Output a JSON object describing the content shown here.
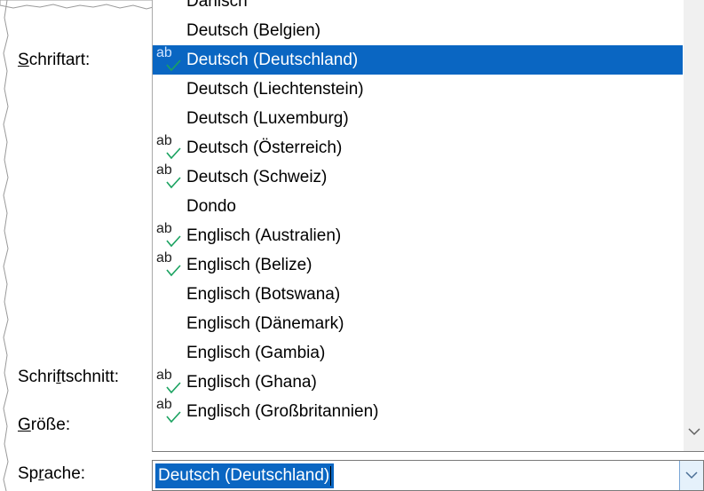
{
  "labels": {
    "font": {
      "pre": "",
      "accel": "S",
      "post": "chriftart:"
    },
    "style": {
      "pre": "Schri",
      "accel": "f",
      "post": "tschnitt:"
    },
    "size": {
      "pre": "",
      "accel": "G",
      "post": "röße:"
    },
    "language": {
      "pre": "Sp",
      "accel": "r",
      "post": "ache:"
    }
  },
  "spell_check_glyph": "ab",
  "language_list": [
    {
      "label": "Dänisch",
      "spellcheck": false,
      "selected": false
    },
    {
      "label": "Deutsch (Belgien)",
      "spellcheck": false,
      "selected": false
    },
    {
      "label": "Deutsch (Deutschland)",
      "spellcheck": true,
      "selected": true
    },
    {
      "label": "Deutsch (Liechtenstein)",
      "spellcheck": false,
      "selected": false
    },
    {
      "label": "Deutsch (Luxemburg)",
      "spellcheck": false,
      "selected": false
    },
    {
      "label": "Deutsch (Österreich)",
      "spellcheck": true,
      "selected": false
    },
    {
      "label": "Deutsch (Schweiz)",
      "spellcheck": true,
      "selected": false
    },
    {
      "label": "Dondo",
      "spellcheck": false,
      "selected": false
    },
    {
      "label": "Englisch (Australien)",
      "spellcheck": true,
      "selected": false
    },
    {
      "label": "Englisch (Belize)",
      "spellcheck": true,
      "selected": false
    },
    {
      "label": "Englisch (Botswana)",
      "spellcheck": false,
      "selected": false
    },
    {
      "label": "Englisch (Dänemark)",
      "spellcheck": false,
      "selected": false
    },
    {
      "label": "Englisch (Gambia)",
      "spellcheck": false,
      "selected": false
    },
    {
      "label": "Englisch (Ghana)",
      "spellcheck": true,
      "selected": false
    },
    {
      "label": "Englisch (Großbritannien)",
      "spellcheck": true,
      "selected": false
    }
  ],
  "language_combo": {
    "value": "Deutsch (Deutschland)"
  },
  "colors": {
    "selection": "#0a66c2",
    "check": "#1aa260"
  }
}
